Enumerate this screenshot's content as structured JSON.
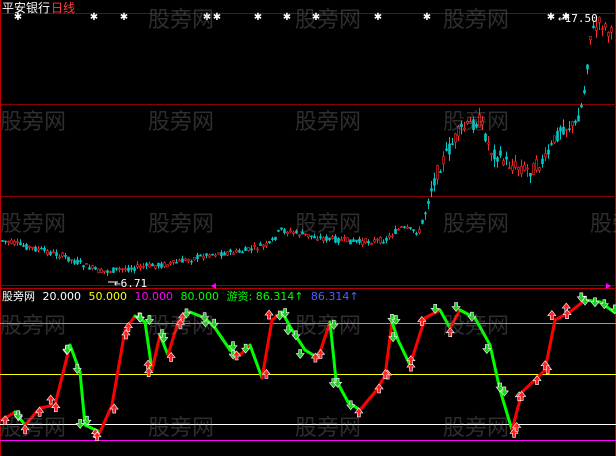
{
  "title": {
    "stock_name": "平安银行",
    "period": "日线"
  },
  "price_panel": {
    "high_label": "17.50",
    "low_label": "6.71"
  },
  "indicator_bar": {
    "name": "股旁网",
    "values": [
      {
        "text": "20.000",
        "color": "#ffffff"
      },
      {
        "text": "50.000",
        "color": "#ffff00"
      },
      {
        "text": "10.000",
        "color": "#ff00ff"
      },
      {
        "text": "80.000",
        "color": "#00ff00"
      },
      {
        "text": "游资: 86.314↑",
        "color": "#00ff00"
      },
      {
        "text": "86.314↑",
        "color": "#5060ff"
      }
    ]
  },
  "watermark": "股旁网",
  "colors": {
    "up": "#ff2a2a",
    "down": "#00c8c8",
    "indicator_up": "#ff0000",
    "indicator_down": "#00ff00",
    "level_80": "#00ff00",
    "level_50": "#ffff00",
    "level_20": "#ffffff",
    "level_10": "#ff00ff"
  }
}
